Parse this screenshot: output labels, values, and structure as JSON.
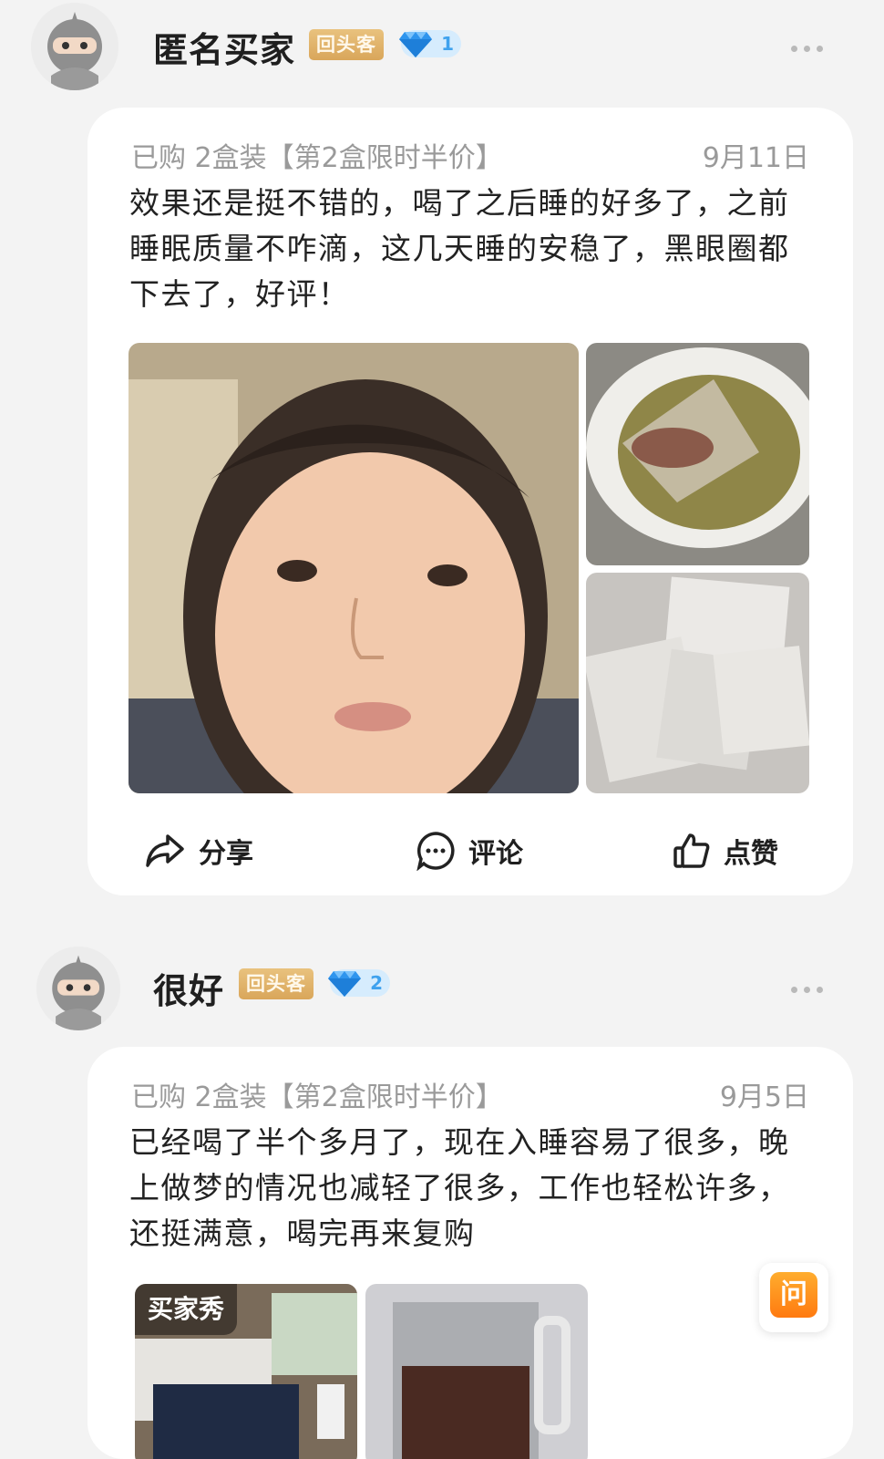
{
  "reviews": [
    {
      "user_name": "匿名买家",
      "badge_repeat": "回头客",
      "badge_level": "1",
      "purchase_info": "已购 2盒装【第2盒限时半价】",
      "date": "9月11日",
      "text": "效果还是挺不错的，喝了之后睡的好多了，之前睡眠质量不咋滴，这几天睡的安稳了，黑眼圈都下去了，好评！",
      "actions": {
        "share": "分享",
        "comment": "评论",
        "like": "点赞"
      }
    },
    {
      "user_name": "很好",
      "badge_repeat": "回头客",
      "badge_level": "2",
      "purchase_info": "已购 2盒装【第2盒限时半价】",
      "date": "9月5日",
      "text": "已经喝了半个多月了，现在入睡容易了很多，晚上做梦的情况也减轻了很多，工作也轻松许多，还挺满意，喝完再来复购",
      "photo_tag": "买家秀"
    }
  ],
  "ask_button": "问",
  "colors": {
    "card": "#ffffff",
    "background": "#f3f3f3",
    "badge_gold": "#d9a65a",
    "level_blue": "#3fa2ee",
    "ask_orange": "#ff8a17"
  }
}
